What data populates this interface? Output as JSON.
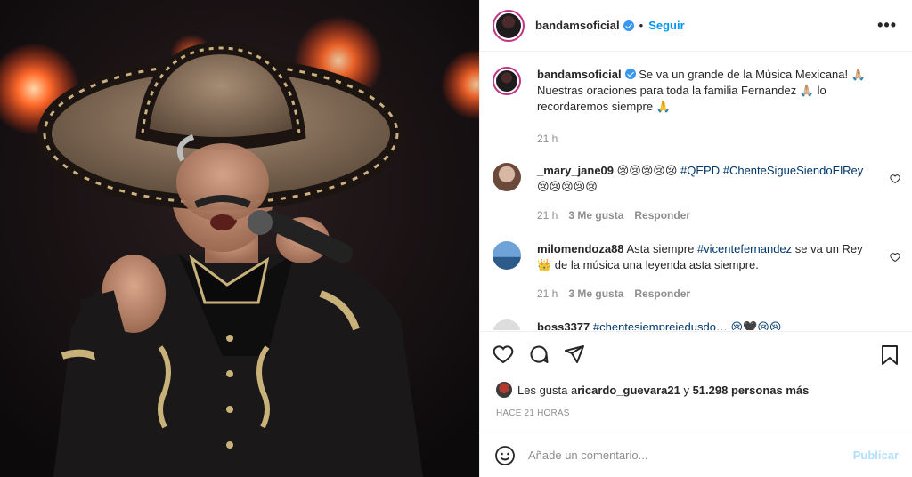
{
  "post": {
    "username": "bandamsoficial",
    "follow_label": "Seguir",
    "more_label": "•••",
    "dot": "•"
  },
  "caption": {
    "username": "bandamsoficial",
    "text": "Se va un grande de la Música Mexicana! 🙏🏼 Nuestras oraciones para toda la familia Fernandez 🙏🏼 lo recordaremos siempre 🙏",
    "time": "21 h"
  },
  "comments": [
    {
      "username": "_mary_jane09",
      "text_prefix": "😢😢😢😢😢 ",
      "tag1": "#QEPD",
      "tag2": "#ChenteSigueSiendoElRey",
      "text_suffix": " 😢😢😢😢😢",
      "time": "21 h",
      "likes": "3 Me gusta",
      "reply": "Responder"
    },
    {
      "username": "milomendoza88",
      "text_prefix": "Asta siempre ",
      "tag1": "#vicentefernandez",
      "text_suffix": " se va un Rey 👑 de la música una leyenda asta siempre.",
      "time": "21 h",
      "likes": "3 Me gusta",
      "reply": "Responder"
    },
    {
      "username": "boss3377",
      "text": "#chentesiempreiedusdo… 😢🖤😢😢"
    }
  ],
  "likes": {
    "prefix": "Les gusta a ",
    "user": "ricardo_guevara21",
    "middle": " y ",
    "count": "51.298 personas más"
  },
  "timestamp": "HACE 21 HORAS",
  "composer": {
    "placeholder": "Añade un comentario...",
    "publish_label": "Publicar"
  },
  "colors": {
    "accent": "#0095f6",
    "hashtag": "#00376b",
    "muted": "#8e8e8e"
  }
}
